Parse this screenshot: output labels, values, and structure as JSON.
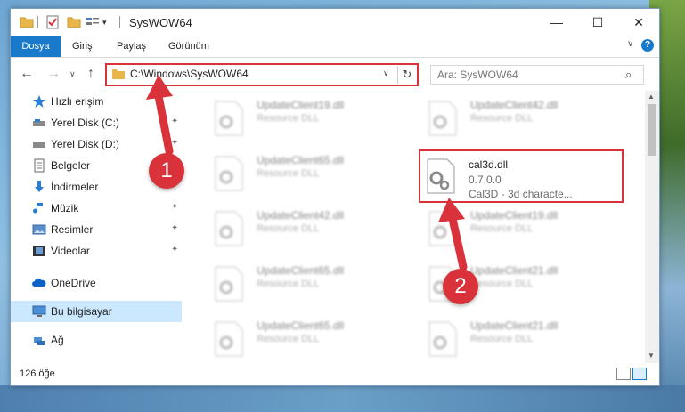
{
  "window": {
    "title": "SysWOW64",
    "controls": {
      "minimize": "—",
      "maximize": "☐",
      "close": "✕"
    }
  },
  "ribbon": {
    "tabs": [
      "Dosya",
      "Giriş",
      "Paylaş",
      "Görünüm"
    ],
    "expand_glyph": "∨",
    "help_glyph": "?"
  },
  "navigation": {
    "back_glyph": "←",
    "forward_glyph": "→",
    "recent_glyph": "∨",
    "up_glyph": "↑",
    "address": "C:\\Windows\\SysWOW64",
    "address_dropdown": "∨",
    "refresh_glyph": "↻",
    "search_placeholder": "Ara: SysWOW64",
    "search_glyph": "⌕"
  },
  "sidebar": {
    "items": [
      {
        "label": "Hızlı erişim",
        "icon": "star-icon",
        "pinned": false
      },
      {
        "label": "Yerel Disk (C:)",
        "icon": "drive-icon",
        "pinned": true
      },
      {
        "label": "Yerel Disk (D:)",
        "icon": "drive-icon",
        "pinned": true
      },
      {
        "label": "Belgeler",
        "icon": "documents-icon",
        "pinned": true
      },
      {
        "label": "İndirmeler",
        "icon": "download-icon",
        "pinned": true
      },
      {
        "label": "Müzik",
        "icon": "music-icon",
        "pinned": true
      },
      {
        "label": "Resimler",
        "icon": "pictures-icon",
        "pinned": true
      },
      {
        "label": "Videolar",
        "icon": "video-icon",
        "pinned": true
      },
      {
        "label": "OneDrive",
        "icon": "cloud-icon",
        "pinned": false
      },
      {
        "label": "Bu bilgisayar",
        "icon": "computer-icon",
        "pinned": false
      },
      {
        "label": "Ağ",
        "icon": "network-icon",
        "pinned": false
      }
    ],
    "pin_glyph": "📌"
  },
  "files": {
    "left_column": [
      {
        "name": "UpdateClient19.dll",
        "desc": "Resource DLL"
      },
      {
        "name": "UpdateClient65.dll",
        "desc": "Resource DLL"
      },
      {
        "name": "UpdateClient42.dll",
        "desc": "Resource DLL"
      },
      {
        "name": "UpdateClient65.dll",
        "desc": "Resource DLL"
      },
      {
        "name": "UpdateClient65.dll",
        "desc": "Resource DLL"
      }
    ],
    "right_column": [
      {
        "name": "UpdateClient42.dll",
        "desc": "Resource DLL"
      },
      {
        "name": "UpdateClient19.dll",
        "desc": "Resource DLL"
      },
      {
        "name": "UpdateClient21.dll",
        "desc": "Resource DLL"
      },
      {
        "name": "UpdateClient21.dll",
        "desc": "Resource DLL"
      }
    ],
    "highlighted": {
      "name": "cal3d.dll",
      "version": "0.7.0.0",
      "desc": "Cal3D - 3d characte..."
    }
  },
  "status": {
    "item_count": "126 öğe"
  },
  "annotations": {
    "step1": "1",
    "step2": "2",
    "color": "#d9323a"
  }
}
